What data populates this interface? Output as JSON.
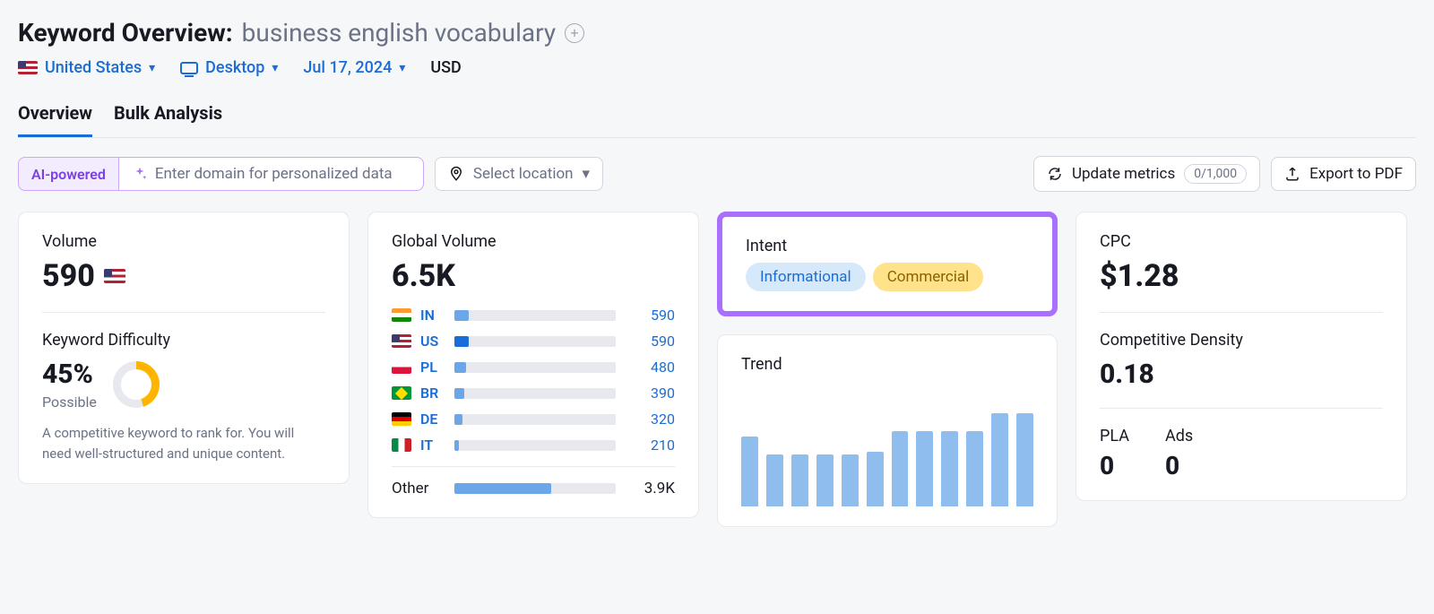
{
  "header": {
    "title_prefix": "Keyword Overview:",
    "keyword": "business english vocabulary"
  },
  "filters": {
    "country": "United States",
    "device": "Desktop",
    "date": "Jul 17, 2024",
    "currency": "USD"
  },
  "tabs": {
    "overview": "Overview",
    "bulk": "Bulk Analysis"
  },
  "toolbar": {
    "ai_label": "AI-powered",
    "domain_placeholder": "Enter domain for personalized data",
    "location_placeholder": "Select location",
    "update_label": "Update metrics",
    "update_count": "0/1,000",
    "export_label": "Export to PDF"
  },
  "volume": {
    "title": "Volume",
    "value": "590",
    "kd_title": "Keyword Difficulty",
    "kd_value": "45%",
    "kd_label": "Possible",
    "kd_desc": "A competitive keyword to rank for. You will need well-structured and unique content."
  },
  "global_volume": {
    "title": "Global Volume",
    "total": "6.5K",
    "rows": [
      {
        "flag": "in",
        "cc": "IN",
        "value": "590",
        "pct": 9,
        "dark": false
      },
      {
        "flag": "us",
        "cc": "US",
        "value": "590",
        "pct": 9,
        "dark": true
      },
      {
        "flag": "pl",
        "cc": "PL",
        "value": "480",
        "pct": 7,
        "dark": false
      },
      {
        "flag": "br",
        "cc": "BR",
        "value": "390",
        "pct": 6,
        "dark": false
      },
      {
        "flag": "de",
        "cc": "DE",
        "value": "320",
        "pct": 5,
        "dark": false
      },
      {
        "flag": "it",
        "cc": "IT",
        "value": "210",
        "pct": 3,
        "dark": false
      }
    ],
    "other_label": "Other",
    "other_value": "3.9K",
    "other_pct": 60
  },
  "intent": {
    "title": "Intent",
    "tags": [
      {
        "label": "Informational",
        "kind": "info"
      },
      {
        "label": "Commercial",
        "kind": "comm"
      }
    ]
  },
  "trend": {
    "title": "Trend"
  },
  "chart_data": {
    "type": "bar",
    "title": "Trend",
    "xlabel": "",
    "ylabel": "",
    "ylim": [
      0,
      100
    ],
    "categories": [
      "1",
      "2",
      "3",
      "4",
      "5",
      "6",
      "7",
      "8",
      "9",
      "10",
      "11",
      "12"
    ],
    "values": [
      60,
      45,
      45,
      45,
      45,
      47,
      65,
      65,
      65,
      65,
      80,
      80
    ]
  },
  "cpc": {
    "title": "CPC",
    "value": "$1.28",
    "cd_title": "Competitive Density",
    "cd_value": "0.18",
    "pla_label": "PLA",
    "pla_value": "0",
    "ads_label": "Ads",
    "ads_value": "0"
  }
}
